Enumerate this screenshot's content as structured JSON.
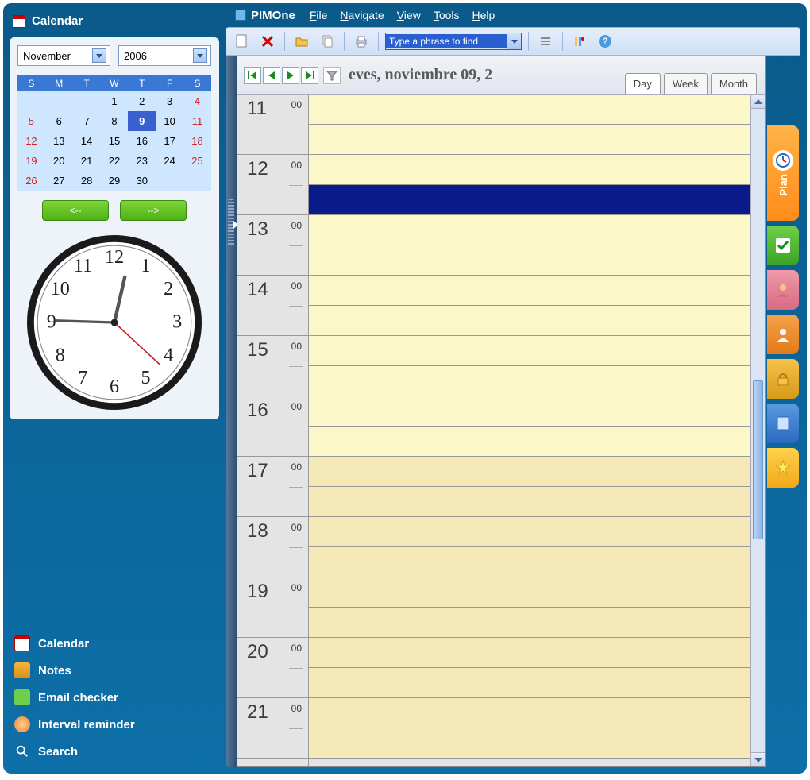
{
  "app_title": "PIMOne",
  "menu": [
    "File",
    "Navigate",
    "View",
    "Tools",
    "Help"
  ],
  "search_placeholder": "Type a phrase to find",
  "sidebar": {
    "title": "Calendar",
    "month": "November",
    "year": "2006",
    "dow": [
      "S",
      "M",
      "T",
      "W",
      "T",
      "F",
      "S"
    ],
    "weeks": [
      [
        "",
        "",
        "",
        1,
        2,
        3,
        4
      ],
      [
        5,
        6,
        7,
        8,
        9,
        10,
        11
      ],
      [
        12,
        13,
        14,
        15,
        16,
        17,
        18
      ],
      [
        19,
        20,
        21,
        22,
        23,
        24,
        25
      ],
      [
        26,
        27,
        28,
        29,
        30,
        "",
        ""
      ]
    ],
    "selected_day": 9,
    "prev_label": "<--",
    "next_label": "-->",
    "clock_time": "12:45:20",
    "nav": [
      "Calendar",
      "Notes",
      "Email checker",
      "Interval reminder",
      "Search"
    ]
  },
  "planner": {
    "date_label": "eves, noviembre 09, 2",
    "view_tabs": [
      "Day",
      "Week",
      "Month"
    ],
    "active_view": "Day",
    "hours": [
      11,
      12,
      13,
      14,
      15,
      16,
      17,
      18,
      19,
      20,
      21
    ],
    "minute_label": "00",
    "evening_start": 17,
    "selected_slot": {
      "hour": 12,
      "half": 1
    }
  },
  "right_tabs": {
    "plan_label": "Plan"
  }
}
